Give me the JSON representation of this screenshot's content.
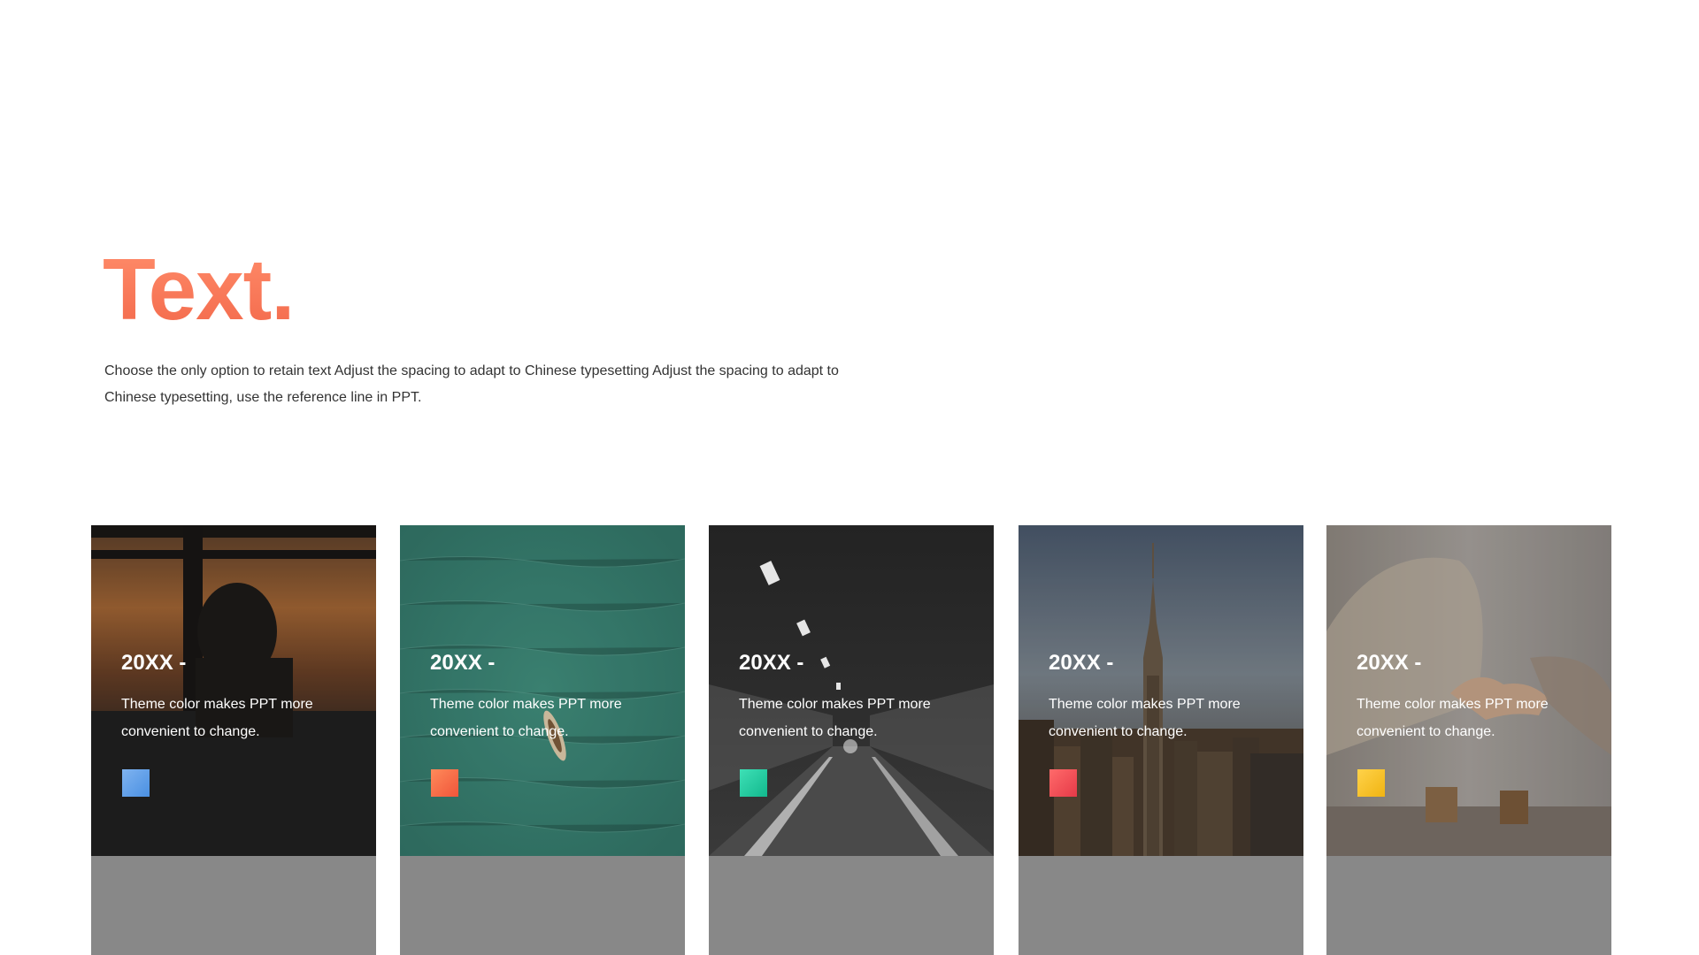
{
  "slide": {
    "title": "Text.",
    "description": "Choose the only option to retain text Adjust the spacing to adapt to Chinese typesetting Adjust the spacing to adapt to Chinese typesetting, use the reference line in PPT."
  },
  "cards": [
    {
      "year": "20XX -",
      "text": "Theme color makes PPT more convenient to change.",
      "photo": "sunset-window-silhouette",
      "accent": "#4a90e2"
    },
    {
      "year": "20XX -",
      "text": "Theme color makes PPT more convenient to change.",
      "photo": "aerial-boat-sea",
      "accent": "#f46a4a"
    },
    {
      "year": "20XX -",
      "text": "Theme color makes PPT more convenient to change.",
      "photo": "tunnel-road",
      "accent": "#1ec9a0"
    },
    {
      "year": "20XX -",
      "text": "Theme color makes PPT more convenient to change.",
      "photo": "city-skyline",
      "accent": "#f04a52"
    },
    {
      "year": "20XX -",
      "text": "Theme color makes PPT more convenient to change.",
      "photo": "business-handshake",
      "accent": "#f5c21b"
    }
  ]
}
